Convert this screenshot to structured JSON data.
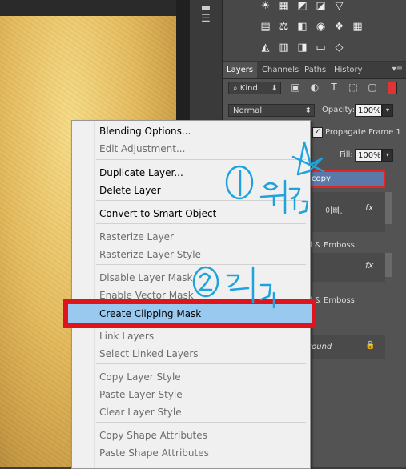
{
  "adjustments_icons": [
    "sun-icon",
    "levels-icon",
    "curves-icon",
    "exposure-icon",
    "triangle-icon",
    "vibrance-icon",
    "balance-icon",
    "bw-icon",
    "photo-filter-icon",
    "mixer-icon",
    "lookup-icon",
    "invert-icon",
    "posterize-icon",
    "threshold-icon",
    "gradient-map-icon",
    "selective-color-icon"
  ],
  "tabs": {
    "layers": "Layers",
    "channels": "Channels",
    "paths": "Paths",
    "history": "History"
  },
  "layers_panel": {
    "filter_kind": "Kind",
    "blend_mode": "Normal",
    "opacity_label": "Opacity:",
    "opacity_value": "100%",
    "propagate_label": "Propagate Frame 1",
    "fill_label": "Fill:",
    "fill_value": "100%",
    "selected_layer_name": "copy",
    "partial_texts": [
      "이빠,",
      "l & Emboss",
      "l & Emboss",
      "round"
    ],
    "fx_label": "fx"
  },
  "context_menu": {
    "items": [
      {
        "label": "Blending Options...",
        "enabled": true
      },
      {
        "label": "Edit Adjustment...",
        "enabled": false
      },
      {
        "label": "Duplicate Layer...",
        "enabled": true
      },
      {
        "label": "Delete Layer",
        "enabled": true
      },
      {
        "label": "Convert to Smart Object",
        "enabled": true
      },
      {
        "label": "Rasterize Layer",
        "enabled": false
      },
      {
        "label": "Rasterize Layer Style",
        "enabled": false
      },
      {
        "label": "Disable Layer Mask",
        "enabled": false
      },
      {
        "label": "Enable Vector Mask",
        "enabled": false
      },
      {
        "label": "Create Clipping Mask",
        "enabled": true,
        "highlighted": true
      },
      {
        "label": "Link Layers",
        "enabled": false
      },
      {
        "label": "Select Linked Layers",
        "enabled": false
      },
      {
        "label": "Copy Layer Style",
        "enabled": false
      },
      {
        "label": "Paste Layer Style",
        "enabled": false
      },
      {
        "label": "Clear Layer Style",
        "enabled": false
      },
      {
        "label": "Copy Shape Attributes",
        "enabled": false
      },
      {
        "label": "Paste Shape Attributes",
        "enabled": false
      }
    ]
  },
  "annotations": {
    "step1_number": "1",
    "step1_text": "우클릭",
    "step2_number": "2",
    "step2_text": "클릭",
    "ink_color": "#1fa3dc",
    "highlight_color": "#e0141c"
  }
}
